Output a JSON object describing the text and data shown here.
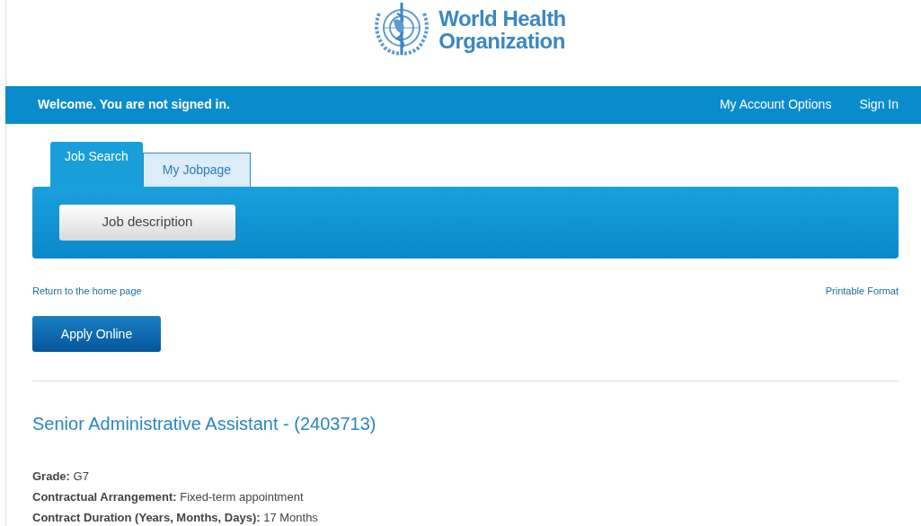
{
  "logo": {
    "line_1": "World Health",
    "line_2": "Organization"
  },
  "top_bar": {
    "welcome": "Welcome. You are not signed in.",
    "links": [
      "My Account Options",
      "Sign In"
    ]
  },
  "tabs": [
    {
      "label": "Job Search",
      "selected": true
    },
    {
      "label": "My Jobpage",
      "selected": false
    }
  ],
  "panel_button": "Job description",
  "links": {
    "left": "Return to the home page",
    "right": "Printable Format"
  },
  "apply_button": "Apply Online",
  "job_title": "Senior Administrative Assistant - (2403713)",
  "details": [
    "**Grade:** G7",
    "**Contractual Arrangement:** Fixed-term appointment",
    "**Contract Duration (Years, Months, Days):** 17 Months"
  ]
}
